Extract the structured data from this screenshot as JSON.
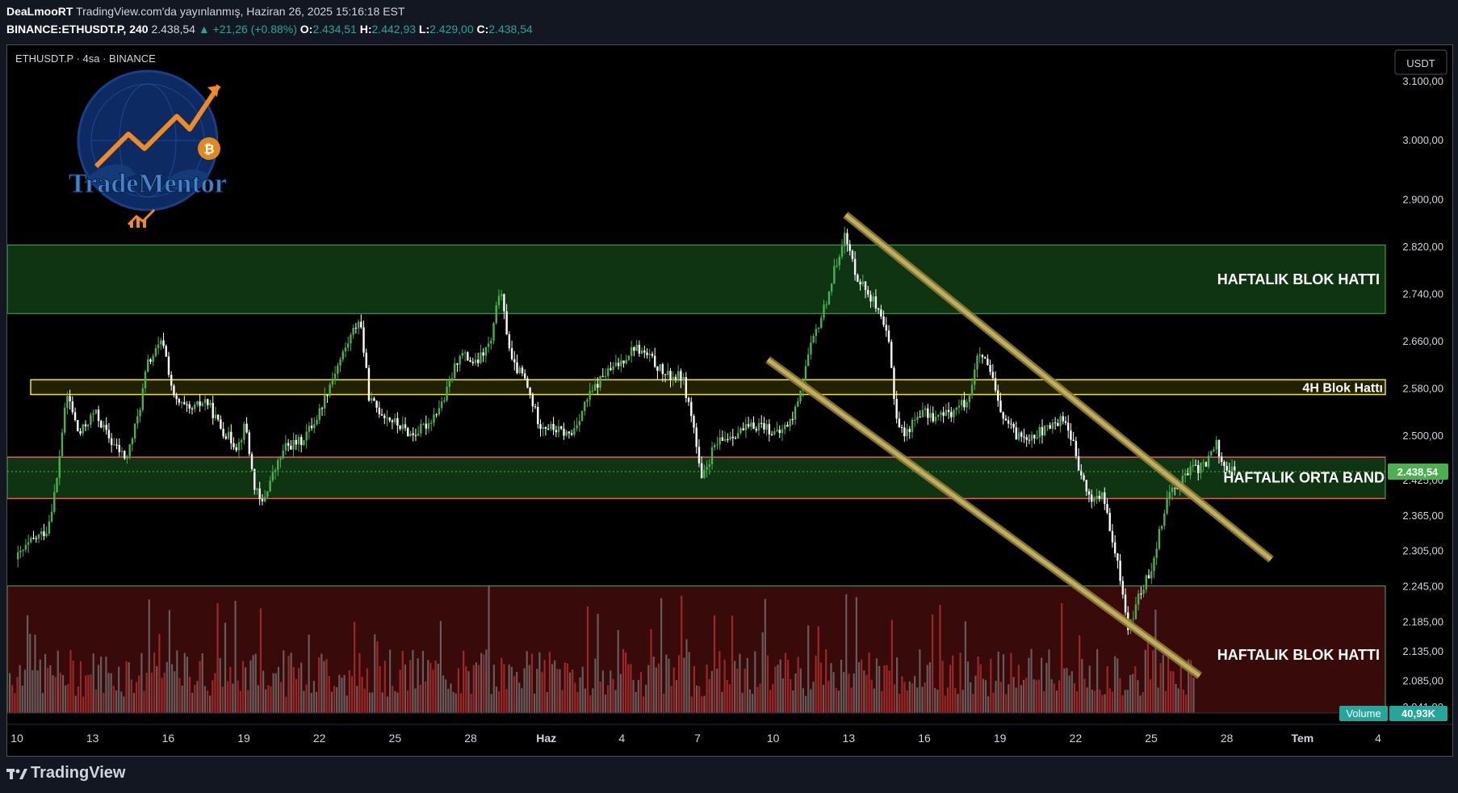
{
  "header": {
    "author": "DeaLmooRT",
    "published": "TradingView.com'da yayınlanmış, Haziran 26, 2025 15:16:18 EST",
    "symbol": "BINANCE:ETHUSDT.P, 240",
    "last": "2.438,54",
    "change": "+21,26 (+0.88%)",
    "o_label": "O:",
    "o": "2.434,51",
    "h_label": "H:",
    "h": "2.442,93",
    "l_label": "L:",
    "l": "2.429,00",
    "c_label": "C:",
    "c": "2.438,54"
  },
  "chart_header": "ETHUSDT.P · 4sa · BINANCE",
  "currency_button": "USDT",
  "logo_text": "TradeMentor",
  "footer_brand": "TradingView",
  "colors": {
    "up": "#26a69a",
    "up_candle": "#4caf50",
    "down_candle": "#ffffff",
    "zone_green": "#1b5e20",
    "zone_red": "#5d1010",
    "yellow_band": "#f5e800",
    "channel": "#c8b560",
    "price_tag": "#4caf50"
  },
  "chart_data": {
    "type": "candlestick",
    "symbol": "ETHUSDT.P",
    "interval": "4sa",
    "exchange": "BINANCE",
    "y_axis": {
      "labels": [
        "3.100,00",
        "3.000,00",
        "2.900,00",
        "2.820,00",
        "2.740,00",
        "2.660,00",
        "2.580,00",
        "2.500,00",
        "2.425,00",
        "2.365,00",
        "2.305,00",
        "2.245,00",
        "2.185,00",
        "2.135,00",
        "2.085,00",
        "2.041,00"
      ],
      "ylim": [
        2030,
        3160
      ]
    },
    "x_axis": {
      "labels": [
        "10",
        "13",
        "16",
        "19",
        "22",
        "25",
        "28",
        "Haz",
        "4",
        "7",
        "10",
        "13",
        "16",
        "19",
        "22",
        "25",
        "28",
        "Tem",
        "4"
      ]
    },
    "price_path": [
      {
        "x": 0,
        "y": 2290
      },
      {
        "x": 1,
        "y": 2320
      },
      {
        "x": 2,
        "y": 2340
      },
      {
        "x": 2.6,
        "y": 2420
      },
      {
        "x": 3,
        "y": 2520
      },
      {
        "x": 3.3,
        "y": 2570
      },
      {
        "x": 4,
        "y": 2500
      },
      {
        "x": 5,
        "y": 2540
      },
      {
        "x": 6,
        "y": 2490
      },
      {
        "x": 7,
        "y": 2460
      },
      {
        "x": 7.8,
        "y": 2540
      },
      {
        "x": 8.3,
        "y": 2620
      },
      {
        "x": 9.3,
        "y": 2660
      },
      {
        "x": 10,
        "y": 2560
      },
      {
        "x": 11,
        "y": 2540
      },
      {
        "x": 12,
        "y": 2560
      },
      {
        "x": 13,
        "y": 2510
      },
      {
        "x": 14,
        "y": 2480
      },
      {
        "x": 14.5,
        "y": 2520
      },
      {
        "x": 15,
        "y": 2420
      },
      {
        "x": 15.5,
        "y": 2380
      },
      {
        "x": 16,
        "y": 2420
      },
      {
        "x": 17,
        "y": 2480
      },
      {
        "x": 18,
        "y": 2490
      },
      {
        "x": 19,
        "y": 2530
      },
      {
        "x": 20,
        "y": 2600
      },
      {
        "x": 21,
        "y": 2660
      },
      {
        "x": 21.7,
        "y": 2700
      },
      {
        "x": 22.3,
        "y": 2560
      },
      {
        "x": 23,
        "y": 2540
      },
      {
        "x": 24,
        "y": 2520
      },
      {
        "x": 25,
        "y": 2500
      },
      {
        "x": 26,
        "y": 2520
      },
      {
        "x": 27,
        "y": 2560
      },
      {
        "x": 28,
        "y": 2640
      },
      {
        "x": 29,
        "y": 2620
      },
      {
        "x": 30,
        "y": 2660
      },
      {
        "x": 30.5,
        "y": 2750
      },
      {
        "x": 31.3,
        "y": 2620
      },
      {
        "x": 32,
        "y": 2600
      },
      {
        "x": 33,
        "y": 2520
      },
      {
        "x": 34,
        "y": 2510
      },
      {
        "x": 35,
        "y": 2500
      },
      {
        "x": 36,
        "y": 2560
      },
      {
        "x": 37,
        "y": 2600
      },
      {
        "x": 38,
        "y": 2620
      },
      {
        "x": 39,
        "y": 2650
      },
      {
        "x": 40,
        "y": 2630
      },
      {
        "x": 41,
        "y": 2600
      },
      {
        "x": 42,
        "y": 2600
      },
      {
        "x": 42.7,
        "y": 2520
      },
      {
        "x": 43.2,
        "y": 2420
      },
      {
        "x": 44,
        "y": 2480
      },
      {
        "x": 45,
        "y": 2500
      },
      {
        "x": 46,
        "y": 2510
      },
      {
        "x": 47,
        "y": 2520
      },
      {
        "x": 48,
        "y": 2500
      },
      {
        "x": 49,
        "y": 2530
      },
      {
        "x": 50,
        "y": 2640
      },
      {
        "x": 51,
        "y": 2720
      },
      {
        "x": 51.8,
        "y": 2800
      },
      {
        "x": 52.2,
        "y": 2840
      },
      {
        "x": 53,
        "y": 2770
      },
      {
        "x": 54,
        "y": 2730
      },
      {
        "x": 55,
        "y": 2660
      },
      {
        "x": 55.5,
        "y": 2530
      },
      {
        "x": 56,
        "y": 2500
      },
      {
        "x": 57,
        "y": 2540
      },
      {
        "x": 58,
        "y": 2530
      },
      {
        "x": 59,
        "y": 2540
      },
      {
        "x": 60,
        "y": 2560
      },
      {
        "x": 60.7,
        "y": 2640
      },
      {
        "x": 61.5,
        "y": 2600
      },
      {
        "x": 62,
        "y": 2540
      },
      {
        "x": 63,
        "y": 2500
      },
      {
        "x": 64,
        "y": 2500
      },
      {
        "x": 65,
        "y": 2510
      },
      {
        "x": 66,
        "y": 2530
      },
      {
        "x": 66.5,
        "y": 2500
      },
      {
        "x": 67,
        "y": 2440
      },
      {
        "x": 67.7,
        "y": 2390
      },
      {
        "x": 68.5,
        "y": 2400
      },
      {
        "x": 69,
        "y": 2330
      },
      {
        "x": 69.6,
        "y": 2260
      },
      {
        "x": 70.1,
        "y": 2170
      },
      {
        "x": 70.8,
        "y": 2230
      },
      {
        "x": 71.5,
        "y": 2270
      },
      {
        "x": 72,
        "y": 2330
      },
      {
        "x": 72.6,
        "y": 2400
      },
      {
        "x": 73.3,
        "y": 2420
      },
      {
        "x": 74,
        "y": 2440
      },
      {
        "x": 75,
        "y": 2450
      },
      {
        "x": 75.6,
        "y": 2490
      },
      {
        "x": 76,
        "y": 2450
      },
      {
        "x": 76.8,
        "y": 2438.54
      }
    ],
    "price_path_note": "",
    "zones": [
      {
        "label": "HAFTALIK  BLOK HATTI",
        "from": 2706,
        "to": 2822,
        "color": "green"
      },
      {
        "label": "4H Blok Hattı",
        "from": 2569,
        "to": 2594,
        "color": "yellow"
      },
      {
        "label": "HAFTALIK ORTA BAND",
        "from": 2393,
        "to": 2463,
        "color": "green"
      },
      {
        "label": "HAFTALIK  BLOK HATTI",
        "from": 2030,
        "to": 2245,
        "color": "red"
      }
    ],
    "channel_lines": [
      {
        "start": {
          "x": 52.3,
          "y": 2873
        },
        "end": {
          "x": 79.1,
          "y": 2290
        }
      },
      {
        "start": {
          "x": 47.4,
          "y": 2628
        },
        "end": {
          "x": 74.6,
          "y": 2093
        }
      }
    ],
    "current_price": "2.438,54",
    "volume": {
      "label": "Volume",
      "value": "40,93K"
    }
  }
}
